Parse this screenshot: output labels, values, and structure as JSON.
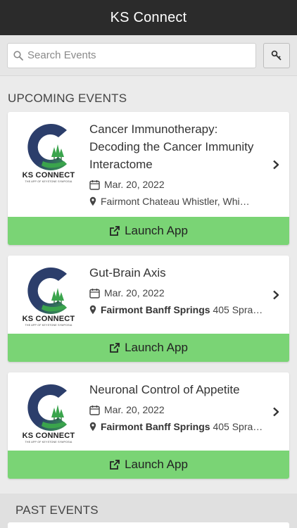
{
  "header": {
    "title": "KS Connect"
  },
  "search": {
    "placeholder": "Search Events",
    "value": ""
  },
  "sections": {
    "upcoming": "UPCOMING EVENTS",
    "past": "PAST EVENTS"
  },
  "logo": {
    "name": "KS CONNECT",
    "tagline": "THE APP OF KEYSTONE SYMPOSIA"
  },
  "events": [
    {
      "title": "Cancer Immunotherapy: Decoding the Cancer Immunity Interactome",
      "date": "Mar. 20, 2022",
      "venue": "Fairmont Chateau Whistler, Whi…",
      "venue_name": "",
      "launch_label": "Launch App"
    },
    {
      "title": "Gut-Brain Axis",
      "date": "Mar. 20, 2022",
      "venue_name": "Fairmont Banff Springs",
      "venue": " 405 Spra…",
      "launch_label": "Launch App"
    },
    {
      "title": "Neuronal Control of Appetite",
      "date": "Mar. 20, 2022",
      "venue_name": "Fairmont Banff Springs",
      "venue": " 405 Spra…",
      "launch_label": "Launch App"
    }
  ],
  "colors": {
    "header": "#2b2b2b",
    "launch": "#7ad475",
    "logo_dark": "#2c3e6b",
    "logo_green": "#3aa44c"
  }
}
